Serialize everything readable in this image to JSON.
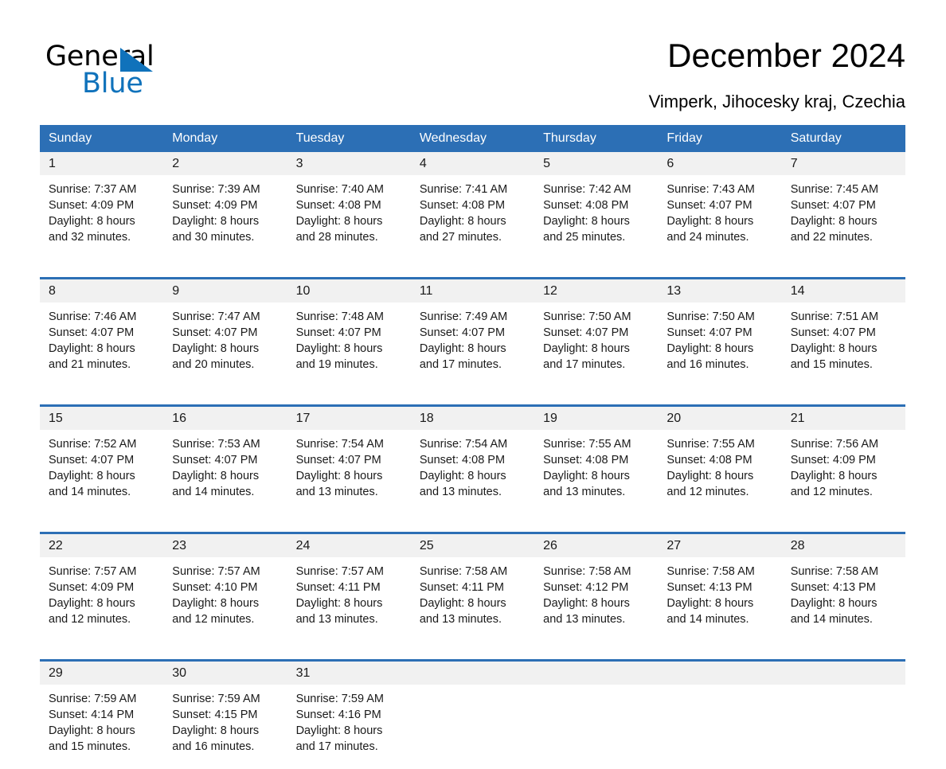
{
  "brand": {
    "word_general": "General",
    "word_blue": "Blue",
    "accent_color": "#1072bb",
    "triangle_icon": "brand-triangle-icon"
  },
  "header": {
    "title": "December 2024",
    "subtitle": "Vimperk, Jihocesky kraj, Czechia"
  },
  "calendar": {
    "header_color": "#2c6fb5",
    "daynum_background": "#f1f1f1",
    "weekday_headers": [
      "Sunday",
      "Monday",
      "Tuesday",
      "Wednesday",
      "Thursday",
      "Friday",
      "Saturday"
    ],
    "weeks": [
      [
        {
          "day": "1",
          "sunrise": "Sunrise: 7:37 AM",
          "sunset": "Sunset: 4:09 PM",
          "daylight_line1": "Daylight: 8 hours",
          "daylight_line2": "and 32 minutes."
        },
        {
          "day": "2",
          "sunrise": "Sunrise: 7:39 AM",
          "sunset": "Sunset: 4:09 PM",
          "daylight_line1": "Daylight: 8 hours",
          "daylight_line2": "and 30 minutes."
        },
        {
          "day": "3",
          "sunrise": "Sunrise: 7:40 AM",
          "sunset": "Sunset: 4:08 PM",
          "daylight_line1": "Daylight: 8 hours",
          "daylight_line2": "and 28 minutes."
        },
        {
          "day": "4",
          "sunrise": "Sunrise: 7:41 AM",
          "sunset": "Sunset: 4:08 PM",
          "daylight_line1": "Daylight: 8 hours",
          "daylight_line2": "and 27 minutes."
        },
        {
          "day": "5",
          "sunrise": "Sunrise: 7:42 AM",
          "sunset": "Sunset: 4:08 PM",
          "daylight_line1": "Daylight: 8 hours",
          "daylight_line2": "and 25 minutes."
        },
        {
          "day": "6",
          "sunrise": "Sunrise: 7:43 AM",
          "sunset": "Sunset: 4:07 PM",
          "daylight_line1": "Daylight: 8 hours",
          "daylight_line2": "and 24 minutes."
        },
        {
          "day": "7",
          "sunrise": "Sunrise: 7:45 AM",
          "sunset": "Sunset: 4:07 PM",
          "daylight_line1": "Daylight: 8 hours",
          "daylight_line2": "and 22 minutes."
        }
      ],
      [
        {
          "day": "8",
          "sunrise": "Sunrise: 7:46 AM",
          "sunset": "Sunset: 4:07 PM",
          "daylight_line1": "Daylight: 8 hours",
          "daylight_line2": "and 21 minutes."
        },
        {
          "day": "9",
          "sunrise": "Sunrise: 7:47 AM",
          "sunset": "Sunset: 4:07 PM",
          "daylight_line1": "Daylight: 8 hours",
          "daylight_line2": "and 20 minutes."
        },
        {
          "day": "10",
          "sunrise": "Sunrise: 7:48 AM",
          "sunset": "Sunset: 4:07 PM",
          "daylight_line1": "Daylight: 8 hours",
          "daylight_line2": "and 19 minutes."
        },
        {
          "day": "11",
          "sunrise": "Sunrise: 7:49 AM",
          "sunset": "Sunset: 4:07 PM",
          "daylight_line1": "Daylight: 8 hours",
          "daylight_line2": "and 17 minutes."
        },
        {
          "day": "12",
          "sunrise": "Sunrise: 7:50 AM",
          "sunset": "Sunset: 4:07 PM",
          "daylight_line1": "Daylight: 8 hours",
          "daylight_line2": "and 17 minutes."
        },
        {
          "day": "13",
          "sunrise": "Sunrise: 7:50 AM",
          "sunset": "Sunset: 4:07 PM",
          "daylight_line1": "Daylight: 8 hours",
          "daylight_line2": "and 16 minutes."
        },
        {
          "day": "14",
          "sunrise": "Sunrise: 7:51 AM",
          "sunset": "Sunset: 4:07 PM",
          "daylight_line1": "Daylight: 8 hours",
          "daylight_line2": "and 15 minutes."
        }
      ],
      [
        {
          "day": "15",
          "sunrise": "Sunrise: 7:52 AM",
          "sunset": "Sunset: 4:07 PM",
          "daylight_line1": "Daylight: 8 hours",
          "daylight_line2": "and 14 minutes."
        },
        {
          "day": "16",
          "sunrise": "Sunrise: 7:53 AM",
          "sunset": "Sunset: 4:07 PM",
          "daylight_line1": "Daylight: 8 hours",
          "daylight_line2": "and 14 minutes."
        },
        {
          "day": "17",
          "sunrise": "Sunrise: 7:54 AM",
          "sunset": "Sunset: 4:07 PM",
          "daylight_line1": "Daylight: 8 hours",
          "daylight_line2": "and 13 minutes."
        },
        {
          "day": "18",
          "sunrise": "Sunrise: 7:54 AM",
          "sunset": "Sunset: 4:08 PM",
          "daylight_line1": "Daylight: 8 hours",
          "daylight_line2": "and 13 minutes."
        },
        {
          "day": "19",
          "sunrise": "Sunrise: 7:55 AM",
          "sunset": "Sunset: 4:08 PM",
          "daylight_line1": "Daylight: 8 hours",
          "daylight_line2": "and 13 minutes."
        },
        {
          "day": "20",
          "sunrise": "Sunrise: 7:55 AM",
          "sunset": "Sunset: 4:08 PM",
          "daylight_line1": "Daylight: 8 hours",
          "daylight_line2": "and 12 minutes."
        },
        {
          "day": "21",
          "sunrise": "Sunrise: 7:56 AM",
          "sunset": "Sunset: 4:09 PM",
          "daylight_line1": "Daylight: 8 hours",
          "daylight_line2": "and 12 minutes."
        }
      ],
      [
        {
          "day": "22",
          "sunrise": "Sunrise: 7:57 AM",
          "sunset": "Sunset: 4:09 PM",
          "daylight_line1": "Daylight: 8 hours",
          "daylight_line2": "and 12 minutes."
        },
        {
          "day": "23",
          "sunrise": "Sunrise: 7:57 AM",
          "sunset": "Sunset: 4:10 PM",
          "daylight_line1": "Daylight: 8 hours",
          "daylight_line2": "and 12 minutes."
        },
        {
          "day": "24",
          "sunrise": "Sunrise: 7:57 AM",
          "sunset": "Sunset: 4:11 PM",
          "daylight_line1": "Daylight: 8 hours",
          "daylight_line2": "and 13 minutes."
        },
        {
          "day": "25",
          "sunrise": "Sunrise: 7:58 AM",
          "sunset": "Sunset: 4:11 PM",
          "daylight_line1": "Daylight: 8 hours",
          "daylight_line2": "and 13 minutes."
        },
        {
          "day": "26",
          "sunrise": "Sunrise: 7:58 AM",
          "sunset": "Sunset: 4:12 PM",
          "daylight_line1": "Daylight: 8 hours",
          "daylight_line2": "and 13 minutes."
        },
        {
          "day": "27",
          "sunrise": "Sunrise: 7:58 AM",
          "sunset": "Sunset: 4:13 PM",
          "daylight_line1": "Daylight: 8 hours",
          "daylight_line2": "and 14 minutes."
        },
        {
          "day": "28",
          "sunrise": "Sunrise: 7:58 AM",
          "sunset": "Sunset: 4:13 PM",
          "daylight_line1": "Daylight: 8 hours",
          "daylight_line2": "and 14 minutes."
        }
      ],
      [
        {
          "day": "29",
          "sunrise": "Sunrise: 7:59 AM",
          "sunset": "Sunset: 4:14 PM",
          "daylight_line1": "Daylight: 8 hours",
          "daylight_line2": "and 15 minutes."
        },
        {
          "day": "30",
          "sunrise": "Sunrise: 7:59 AM",
          "sunset": "Sunset: 4:15 PM",
          "daylight_line1": "Daylight: 8 hours",
          "daylight_line2": "and 16 minutes."
        },
        {
          "day": "31",
          "sunrise": "Sunrise: 7:59 AM",
          "sunset": "Sunset: 4:16 PM",
          "daylight_line1": "Daylight: 8 hours",
          "daylight_line2": "and 17 minutes."
        },
        {
          "day": "",
          "sunrise": "",
          "sunset": "",
          "daylight_line1": "",
          "daylight_line2": ""
        },
        {
          "day": "",
          "sunrise": "",
          "sunset": "",
          "daylight_line1": "",
          "daylight_line2": ""
        },
        {
          "day": "",
          "sunrise": "",
          "sunset": "",
          "daylight_line1": "",
          "daylight_line2": ""
        },
        {
          "day": "",
          "sunrise": "",
          "sunset": "",
          "daylight_line1": "",
          "daylight_line2": ""
        }
      ]
    ]
  }
}
